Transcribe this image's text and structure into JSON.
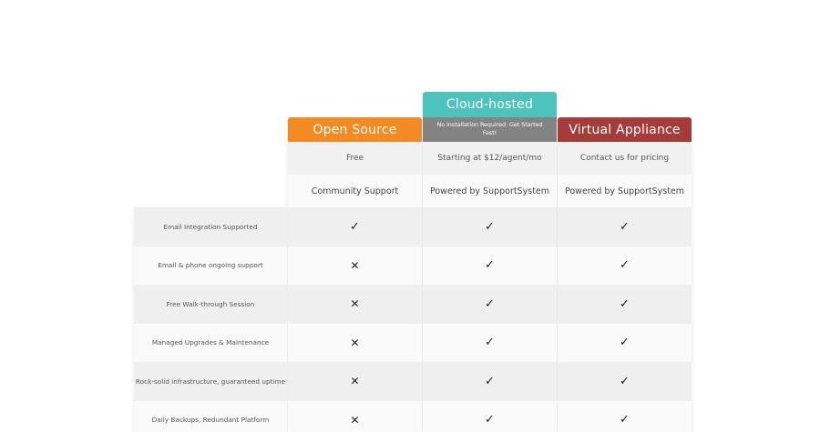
{
  "plans": [
    {
      "name": "Open Source",
      "subtitle": "",
      "price": "Free",
      "support": "Community Support",
      "color": "#f48a22"
    },
    {
      "name": "Cloud-hosted",
      "subtitle": "No Installation Required. Get Started Fast!",
      "price": "Starting at $12/agent/mo",
      "support": "Powered by SupportSystem",
      "color": "#4dc3bd"
    },
    {
      "name": "Virtual Appliance",
      "subtitle": "",
      "price": "Contact us for pricing",
      "support": "Powered by SupportSystem",
      "color": "#a53c39"
    }
  ],
  "features": [
    {
      "label": "Email Integration Supported",
      "marks": [
        "✓",
        "✓",
        "✓"
      ]
    },
    {
      "label": "Email & phone ongoing support",
      "marks": [
        "✕",
        "✓",
        "✓"
      ]
    },
    {
      "label": "Free Walk-through Session",
      "marks": [
        "✕",
        "✓",
        "✓"
      ]
    },
    {
      "label": "Managed Upgrades & Maintenance",
      "marks": [
        "✕",
        "✓",
        "✓"
      ]
    },
    {
      "label": "Rock-solid infrastructure, guaranteed uptime",
      "marks": [
        "✕",
        "✓",
        "✓"
      ]
    },
    {
      "label": "Daily Backups, Redundant Platform",
      "marks": [
        "✕",
        "✓",
        "✓"
      ]
    }
  ],
  "icons": {
    "check": "check-icon",
    "cross": "cross-icon"
  }
}
